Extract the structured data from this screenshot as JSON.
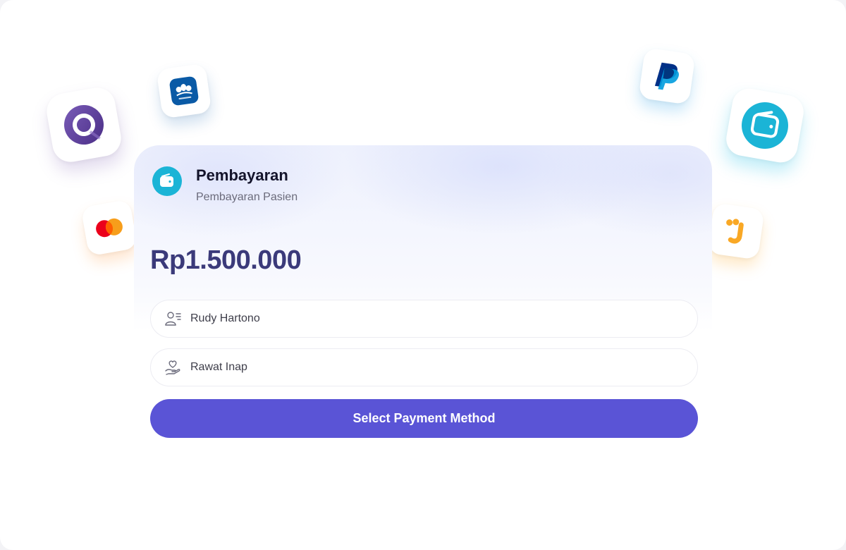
{
  "card": {
    "title": "Pembayaran",
    "subtitle": "Pembayaran Pasien",
    "amount": "Rp1.500.000",
    "header_icon": "wallet-icon"
  },
  "fields": {
    "patient_name": {
      "value": "Rudy Hartono",
      "icon": "user-list-icon"
    },
    "care_type": {
      "value": "Rawat Inap",
      "icon": "heart-hand-icon"
    }
  },
  "actions": {
    "select_payment_label": "Select Payment Method"
  },
  "payment_logos": [
    {
      "name": "ovo-logo",
      "color": "#5c3d99"
    },
    {
      "name": "bca-logo",
      "color": "#0060af"
    },
    {
      "name": "mastercard-logo",
      "color": "#eb001b"
    },
    {
      "name": "paypal-logo",
      "color": "#003087"
    },
    {
      "name": "wallet-app-logo",
      "color": "#1bb4d6"
    },
    {
      "name": "jenius-logo",
      "color": "#f9a825"
    }
  ],
  "colors": {
    "accent": "#5a54d6",
    "amount_text": "#3b3a7a",
    "icon_circle": "#1bb4d6"
  }
}
